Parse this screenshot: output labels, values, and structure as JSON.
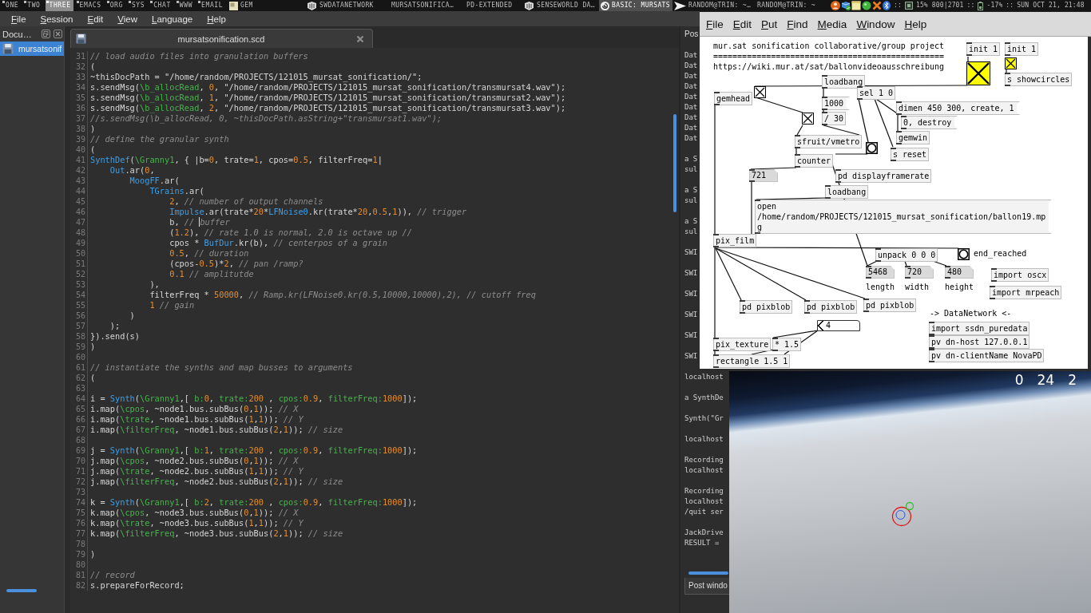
{
  "top_panel": {
    "workspaces": [
      {
        "label": "ONE",
        "selected": false,
        "occupied": true
      },
      {
        "label": "TWO",
        "selected": false,
        "occupied": true
      },
      {
        "label": "THREE",
        "selected": true,
        "occupied": true
      },
      {
        "label": "EMACS",
        "selected": false,
        "occupied": true
      },
      {
        "label": "ORG",
        "selected": false,
        "occupied": true
      },
      {
        "label": "SYS",
        "selected": false,
        "occupied": true
      },
      {
        "label": "CHAT",
        "selected": false,
        "occupied": true
      },
      {
        "label": "WWW",
        "selected": false,
        "occupied": true
      },
      {
        "label": "EMAIL",
        "selected": false,
        "occupied": true
      }
    ],
    "tasks": [
      {
        "label": "GEM",
        "selected": false
      },
      {
        "label": "SWDATANETWORK",
        "selected": false
      },
      {
        "label": "MURSATSONIFICA…",
        "selected": false
      },
      {
        "label": "PD-EXTENDED",
        "selected": false
      },
      {
        "label": "SENSEWORLD DA…",
        "selected": false
      },
      {
        "label": "BASIC: MURSATS",
        "selected": true
      },
      {
        "label": "RANDOM@TRIN: ~…",
        "selected": false
      },
      {
        "label": "RANDOM@TRIN: ~",
        "selected": false
      }
    ],
    "status": [
      {
        "kind": "separator",
        "text": "::"
      },
      {
        "kind": "cpu",
        "text": "15% 800|2701"
      },
      {
        "kind": "separator",
        "text": "::"
      },
      {
        "kind": "battery",
        "text": "-17%"
      },
      {
        "kind": "separator",
        "text": "::"
      },
      {
        "kind": "clock",
        "text": "SUN OCT 21, 21:48"
      }
    ]
  },
  "ide_menu": [
    "File",
    "Session",
    "Edit",
    "View",
    "Language",
    "Help"
  ],
  "documents_panel": {
    "title": "Docu…",
    "items": [
      {
        "label": "mursatsonif",
        "selected": true
      }
    ]
  },
  "editor": {
    "tab_title": "mursatsonification.scd",
    "lines": [
      {
        "number": "31",
        "tokens": [
          {
            "kind": "comment",
            "text": "// load audio files into granulation buffers"
          }
        ]
      },
      {
        "number": "32",
        "tokens": [
          {
            "kind": "plain",
            "text": "("
          }
        ]
      },
      {
        "number": "33",
        "tokens": [
          {
            "kind": "plain",
            "text": "~thisDocPath = \"/home/random/PROJECTS/121015_mursat_sonification/\";"
          }
        ]
      },
      {
        "number": "34",
        "tokens": [
          {
            "kind": "plain",
            "text": "s.sendMsg("
          },
          {
            "kind": "symbol",
            "text": "\\b_allocRead"
          },
          {
            "kind": "plain",
            "text": ", "
          },
          {
            "kind": "number",
            "text": "0"
          },
          {
            "kind": "plain",
            "text": ", \"/home/random/PROJECTS/121015_mursat_sonification/transmursat4.wav\");"
          }
        ]
      },
      {
        "number": "35",
        "tokens": [
          {
            "kind": "plain",
            "text": "s.sendMsg("
          },
          {
            "kind": "symbol",
            "text": "\\b_allocRead"
          },
          {
            "kind": "plain",
            "text": ", "
          },
          {
            "kind": "number",
            "text": "1"
          },
          {
            "kind": "plain",
            "text": ", \"/home/random/PROJECTS/121015_mursat_sonification/transmursat2.wav\");"
          }
        ]
      },
      {
        "number": "36",
        "tokens": [
          {
            "kind": "plain",
            "text": "s.sendMsg("
          },
          {
            "kind": "symbol",
            "text": "\\b_allocRead"
          },
          {
            "kind": "plain",
            "text": ", "
          },
          {
            "kind": "number",
            "text": "2"
          },
          {
            "kind": "plain",
            "text": ", \"/home/random/PROJECTS/121015_mursat_sonification/transmursat3.wav\");"
          }
        ]
      },
      {
        "number": "37",
        "tokens": [
          {
            "kind": "comment",
            "text": "//s.sendMsg(\\b_allocRead, 0, ~thisDocPath.asString+\"transmursat1.wav\");"
          }
        ]
      },
      {
        "number": "38",
        "tokens": [
          {
            "kind": "plain",
            "text": ")"
          }
        ]
      },
      {
        "number": "39",
        "tokens": [
          {
            "kind": "comment",
            "text": "// define the granular synth"
          }
        ]
      },
      {
        "number": "40",
        "tokens": [
          {
            "kind": "plain",
            "text": "("
          }
        ]
      },
      {
        "number": "41",
        "tokens": [
          {
            "kind": "class",
            "text": "SynthDef"
          },
          {
            "kind": "plain",
            "text": "("
          },
          {
            "kind": "symbol",
            "text": "\\Granny1"
          },
          {
            "kind": "plain",
            "text": ", { |b="
          },
          {
            "kind": "number",
            "text": "0"
          },
          {
            "kind": "plain",
            "text": ", trate="
          },
          {
            "kind": "number",
            "text": "1"
          },
          {
            "kind": "plain",
            "text": ", cpos="
          },
          {
            "kind": "number",
            "text": "0.5"
          },
          {
            "kind": "plain",
            "text": ", filterFreq="
          },
          {
            "kind": "number",
            "text": "1"
          },
          {
            "kind": "plain",
            "text": "|"
          }
        ]
      },
      {
        "number": "42",
        "tokens": [
          {
            "kind": "class",
            "text": "    Out"
          },
          {
            "kind": "plain",
            "text": ".ar("
          },
          {
            "kind": "number",
            "text": "0"
          },
          {
            "kind": "plain",
            "text": ","
          }
        ]
      },
      {
        "number": "43",
        "tokens": [
          {
            "kind": "class",
            "text": "        MoogFF"
          },
          {
            "kind": "plain",
            "text": ".ar("
          }
        ]
      },
      {
        "number": "44",
        "tokens": [
          {
            "kind": "class",
            "text": "            TGrains"
          },
          {
            "kind": "plain",
            "text": ".ar("
          }
        ]
      },
      {
        "number": "45",
        "tokens": [
          {
            "kind": "number",
            "text": "                2"
          },
          {
            "kind": "plain",
            "text": ", "
          },
          {
            "kind": "comment",
            "text": "// number of output channels"
          }
        ]
      },
      {
        "number": "46",
        "tokens": [
          {
            "kind": "class",
            "text": "                Impulse"
          },
          {
            "kind": "plain",
            "text": ".ar(trate*"
          },
          {
            "kind": "number",
            "text": "20"
          },
          {
            "kind": "plain",
            "text": "*"
          },
          {
            "kind": "class",
            "text": "LFNoise0"
          },
          {
            "kind": "plain",
            "text": ".kr(trate*"
          },
          {
            "kind": "number",
            "text": "20"
          },
          {
            "kind": "plain",
            "text": ","
          },
          {
            "kind": "number",
            "text": "0.5"
          },
          {
            "kind": "plain",
            "text": ","
          },
          {
            "kind": "number",
            "text": "1"
          },
          {
            "kind": "plain",
            "text": ")), "
          },
          {
            "kind": "comment",
            "text": "// trigger"
          }
        ]
      },
      {
        "number": "47",
        "tokens": [
          {
            "kind": "plain",
            "text": "                b, "
          },
          {
            "kind": "comment",
            "text": "// "
          },
          {
            "kind": "cursor"
          },
          {
            "kind": "comment",
            "text": "buffer"
          }
        ]
      },
      {
        "number": "48",
        "tokens": [
          {
            "kind": "plain",
            "text": "                ("
          },
          {
            "kind": "number",
            "text": "1.2"
          },
          {
            "kind": "plain",
            "text": "), "
          },
          {
            "kind": "comment",
            "text": "// rate 1.0 is normal, 2.0 is octave up //"
          }
        ]
      },
      {
        "number": "49",
        "tokens": [
          {
            "kind": "plain",
            "text": "                cpos * "
          },
          {
            "kind": "class",
            "text": "BufDur"
          },
          {
            "kind": "plain",
            "text": ".kr(b), "
          },
          {
            "kind": "comment",
            "text": "// centerpos of a grain"
          }
        ]
      },
      {
        "number": "50",
        "tokens": [
          {
            "kind": "number",
            "text": "                0.5"
          },
          {
            "kind": "plain",
            "text": ", "
          },
          {
            "kind": "comment",
            "text": "// duration"
          }
        ]
      },
      {
        "number": "51",
        "tokens": [
          {
            "kind": "plain",
            "text": "                (cpos-"
          },
          {
            "kind": "number",
            "text": "0.5"
          },
          {
            "kind": "plain",
            "text": ")*"
          },
          {
            "kind": "number",
            "text": "2"
          },
          {
            "kind": "plain",
            "text": ", "
          },
          {
            "kind": "comment",
            "text": "// pan /ramp?"
          }
        ]
      },
      {
        "number": "52",
        "tokens": [
          {
            "kind": "number",
            "text": "                0.1 "
          },
          {
            "kind": "comment",
            "text": "// amplitutde"
          }
        ]
      },
      {
        "number": "53",
        "tokens": [
          {
            "kind": "plain",
            "text": "            ),"
          }
        ]
      },
      {
        "number": "54",
        "tokens": [
          {
            "kind": "plain",
            "text": "            filterFreq * "
          },
          {
            "kind": "number",
            "text": "50000"
          },
          {
            "kind": "plain",
            "text": ", "
          },
          {
            "kind": "comment",
            "text": "// Ramp.kr(LFNoise0.kr(0.5,10000,10000),2), // cutoff freq"
          }
        ]
      },
      {
        "number": "55",
        "tokens": [
          {
            "kind": "number",
            "text": "            1 "
          },
          {
            "kind": "comment",
            "text": "// gain"
          }
        ]
      },
      {
        "number": "56",
        "tokens": [
          {
            "kind": "plain",
            "text": "        )"
          }
        ]
      },
      {
        "number": "57",
        "tokens": [
          {
            "kind": "plain",
            "text": "    );"
          }
        ]
      },
      {
        "number": "58",
        "tokens": [
          {
            "kind": "plain",
            "text": "}).send(s)"
          }
        ]
      },
      {
        "number": "59",
        "tokens": [
          {
            "kind": "plain",
            "text": ")"
          }
        ]
      },
      {
        "number": "60"
      },
      {
        "number": "61",
        "tokens": [
          {
            "kind": "comment",
            "text": "// instantiate the synths and map busses to arguments"
          }
        ]
      },
      {
        "number": "62",
        "tokens": [
          {
            "kind": "plain",
            "text": "("
          }
        ]
      },
      {
        "number": "63"
      },
      {
        "number": "64",
        "tokens": [
          {
            "kind": "plain",
            "text": "i = "
          },
          {
            "kind": "class",
            "text": "Synth"
          },
          {
            "kind": "plain",
            "text": "("
          },
          {
            "kind": "symbol",
            "text": "\\Granny1"
          },
          {
            "kind": "plain",
            "text": ",[ "
          },
          {
            "kind": "symbol",
            "text": "b:"
          },
          {
            "kind": "number",
            "text": "0"
          },
          {
            "kind": "plain",
            "text": ", "
          },
          {
            "kind": "symbol",
            "text": "trate:"
          },
          {
            "kind": "number",
            "text": "200"
          },
          {
            "kind": "plain",
            "text": " , "
          },
          {
            "kind": "symbol",
            "text": "cpos:"
          },
          {
            "kind": "number",
            "text": "0.9"
          },
          {
            "kind": "plain",
            "text": ", "
          },
          {
            "kind": "symbol",
            "text": "filterFreq:"
          },
          {
            "kind": "number",
            "text": "1000"
          },
          {
            "kind": "plain",
            "text": "]);"
          }
        ]
      },
      {
        "number": "65",
        "tokens": [
          {
            "kind": "plain",
            "text": "i.map("
          },
          {
            "kind": "symbol",
            "text": "\\cpos"
          },
          {
            "kind": "plain",
            "text": ", ~node1.bus.subBus("
          },
          {
            "kind": "number",
            "text": "0"
          },
          {
            "kind": "plain",
            "text": ","
          },
          {
            "kind": "number",
            "text": "1"
          },
          {
            "kind": "plain",
            "text": ")); "
          },
          {
            "kind": "comment",
            "text": "// X"
          }
        ]
      },
      {
        "number": "66",
        "tokens": [
          {
            "kind": "plain",
            "text": "i.map("
          },
          {
            "kind": "symbol",
            "text": "\\trate"
          },
          {
            "kind": "plain",
            "text": ", ~node1.bus.subBus("
          },
          {
            "kind": "number",
            "text": "1"
          },
          {
            "kind": "plain",
            "text": ","
          },
          {
            "kind": "number",
            "text": "1"
          },
          {
            "kind": "plain",
            "text": ")); "
          },
          {
            "kind": "comment",
            "text": "// Y"
          }
        ]
      },
      {
        "number": "67",
        "tokens": [
          {
            "kind": "plain",
            "text": "i.map("
          },
          {
            "kind": "symbol",
            "text": "\\filterFreq"
          },
          {
            "kind": "plain",
            "text": ", ~node1.bus.subBus("
          },
          {
            "kind": "number",
            "text": "2"
          },
          {
            "kind": "plain",
            "text": ","
          },
          {
            "kind": "number",
            "text": "1"
          },
          {
            "kind": "plain",
            "text": ")); "
          },
          {
            "kind": "comment",
            "text": "// size"
          }
        ]
      },
      {
        "number": "68"
      },
      {
        "number": "69",
        "tokens": [
          {
            "kind": "plain",
            "text": "j = "
          },
          {
            "kind": "class",
            "text": "Synth"
          },
          {
            "kind": "plain",
            "text": "("
          },
          {
            "kind": "symbol",
            "text": "\\Granny1"
          },
          {
            "kind": "plain",
            "text": ",[ "
          },
          {
            "kind": "symbol",
            "text": "b:"
          },
          {
            "kind": "number",
            "text": "1"
          },
          {
            "kind": "plain",
            "text": ", "
          },
          {
            "kind": "symbol",
            "text": "trate:"
          },
          {
            "kind": "number",
            "text": "200"
          },
          {
            "kind": "plain",
            "text": " , "
          },
          {
            "kind": "symbol",
            "text": "cpos:"
          },
          {
            "kind": "number",
            "text": "0.9"
          },
          {
            "kind": "plain",
            "text": ", "
          },
          {
            "kind": "symbol",
            "text": "filterFreq:"
          },
          {
            "kind": "number",
            "text": "1000"
          },
          {
            "kind": "plain",
            "text": "]);"
          }
        ]
      },
      {
        "number": "70",
        "tokens": [
          {
            "kind": "plain",
            "text": "j.map("
          },
          {
            "kind": "symbol",
            "text": "\\cpos"
          },
          {
            "kind": "plain",
            "text": ", ~node2.bus.subBus("
          },
          {
            "kind": "number",
            "text": "0"
          },
          {
            "kind": "plain",
            "text": ","
          },
          {
            "kind": "number",
            "text": "1"
          },
          {
            "kind": "plain",
            "text": ")); "
          },
          {
            "kind": "comment",
            "text": "// X"
          }
        ]
      },
      {
        "number": "71",
        "tokens": [
          {
            "kind": "plain",
            "text": "j.map("
          },
          {
            "kind": "symbol",
            "text": "\\trate"
          },
          {
            "kind": "plain",
            "text": ", ~node2.bus.subBus("
          },
          {
            "kind": "number",
            "text": "1"
          },
          {
            "kind": "plain",
            "text": ","
          },
          {
            "kind": "number",
            "text": "1"
          },
          {
            "kind": "plain",
            "text": ")); "
          },
          {
            "kind": "comment",
            "text": "// Y"
          }
        ]
      },
      {
        "number": "72",
        "tokens": [
          {
            "kind": "plain",
            "text": "j.map("
          },
          {
            "kind": "symbol",
            "text": "\\filterFreq"
          },
          {
            "kind": "plain",
            "text": ", ~node2.bus.subBus("
          },
          {
            "kind": "number",
            "text": "2"
          },
          {
            "kind": "plain",
            "text": ","
          },
          {
            "kind": "number",
            "text": "1"
          },
          {
            "kind": "plain",
            "text": ")); "
          },
          {
            "kind": "comment",
            "text": "// size"
          }
        ]
      },
      {
        "number": "73"
      },
      {
        "number": "74",
        "tokens": [
          {
            "kind": "plain",
            "text": "k = "
          },
          {
            "kind": "class",
            "text": "Synth"
          },
          {
            "kind": "plain",
            "text": "("
          },
          {
            "kind": "symbol",
            "text": "\\Granny1"
          },
          {
            "kind": "plain",
            "text": ",[ "
          },
          {
            "kind": "symbol",
            "text": "b:"
          },
          {
            "kind": "number",
            "text": "2"
          },
          {
            "kind": "plain",
            "text": ", "
          },
          {
            "kind": "symbol",
            "text": "trate:"
          },
          {
            "kind": "number",
            "text": "200"
          },
          {
            "kind": "plain",
            "text": " , "
          },
          {
            "kind": "symbol",
            "text": "cpos:"
          },
          {
            "kind": "number",
            "text": "0.9"
          },
          {
            "kind": "plain",
            "text": ", "
          },
          {
            "kind": "symbol",
            "text": "filterFreq:"
          },
          {
            "kind": "number",
            "text": "1000"
          },
          {
            "kind": "plain",
            "text": "]);"
          }
        ]
      },
      {
        "number": "75",
        "tokens": [
          {
            "kind": "plain",
            "text": "k.map("
          },
          {
            "kind": "symbol",
            "text": "\\cpos"
          },
          {
            "kind": "plain",
            "text": ", ~node3.bus.subBus("
          },
          {
            "kind": "number",
            "text": "0"
          },
          {
            "kind": "plain",
            "text": ","
          },
          {
            "kind": "number",
            "text": "1"
          },
          {
            "kind": "plain",
            "text": ")); "
          },
          {
            "kind": "comment",
            "text": "// X"
          }
        ]
      },
      {
        "number": "76",
        "tokens": [
          {
            "kind": "plain",
            "text": "k.map("
          },
          {
            "kind": "symbol",
            "text": "\\trate"
          },
          {
            "kind": "plain",
            "text": ", ~node3.bus.subBus("
          },
          {
            "kind": "number",
            "text": "1"
          },
          {
            "kind": "plain",
            "text": ","
          },
          {
            "kind": "number",
            "text": "1"
          },
          {
            "kind": "plain",
            "text": ")); "
          },
          {
            "kind": "comment",
            "text": "// Y"
          }
        ]
      },
      {
        "number": "77",
        "tokens": [
          {
            "kind": "plain",
            "text": "k.map("
          },
          {
            "kind": "symbol",
            "text": "\\filterFreq"
          },
          {
            "kind": "plain",
            "text": ", ~node3.bus.subBus("
          },
          {
            "kind": "number",
            "text": "2"
          },
          {
            "kind": "plain",
            "text": ","
          },
          {
            "kind": "number",
            "text": "1"
          },
          {
            "kind": "plain",
            "text": ")); "
          },
          {
            "kind": "comment",
            "text": "// size"
          }
        ]
      },
      {
        "number": "78"
      },
      {
        "number": "79",
        "tokens": [
          {
            "kind": "plain",
            "text": ")"
          }
        ]
      },
      {
        "number": "80"
      },
      {
        "number": "81",
        "tokens": [
          {
            "kind": "comment",
            "text": "// record"
          }
        ]
      },
      {
        "number": "82",
        "tokens": [
          {
            "kind": "plain",
            "text": "s.prepareForRecord;"
          }
        ]
      }
    ]
  },
  "post_window": {
    "title": "Pos",
    "entries": [
      [
        "Dat",
        "Dat",
        "Dat",
        "Dat",
        "Dat",
        "Dat",
        "Dat",
        "Dat",
        "Dat"
      ],
      [
        "a S",
        "sul"
      ],
      [
        "a S",
        "sul"
      ],
      [
        "a S",
        "sul"
      ],
      [
        "SWI"
      ],
      [
        "SWI"
      ],
      [
        "SWI"
      ],
      [
        "SWI"
      ],
      [
        "SWI"
      ],
      [
        "SWI"
      ],
      [
        "localhost"
      ],
      [
        "a SynthDe"
      ],
      [
        "Synth(\"Gr"
      ],
      [
        "localhost"
      ],
      [
        "Recording",
        "localhost"
      ],
      [
        "Recording",
        "localhost",
        "/quit ser"
      ],
      [
        "JackDrive",
        "RESULT ="
      ]
    ],
    "tab_label": "Post windo"
  },
  "pd_window": {
    "menu": [
      "File",
      "Edit",
      "Put",
      "Find",
      "Media",
      "Window",
      "Help"
    ],
    "objects": [
      {
        "kind": "comment",
        "text": "mur.sat sonification collaborative/group project ================================================ https://wiki.mur.at/sat/ballonvideoausschreibung"
      },
      {
        "kind": "object",
        "text": "init 1"
      },
      {
        "kind": "object",
        "text": "init 1"
      },
      {
        "kind": "object",
        "text": "loadbang"
      },
      {
        "kind": "toggle",
        "checked": true,
        "color": "#ffff00"
      },
      {
        "kind": "toggle",
        "checked": true,
        "color": "#ffff00"
      },
      {
        "kind": "object",
        "text": "s showcircles"
      },
      {
        "kind": "object",
        "text": "gemhead"
      },
      {
        "kind": "toggle",
        "checked": true
      },
      {
        "kind": "message",
        "text": "1000"
      },
      {
        "kind": "object",
        "text": "sel 1 0"
      },
      {
        "kind": "toggle",
        "checked": true
      },
      {
        "kind": "object",
        "text": "/ 30"
      },
      {
        "kind": "message",
        "text": "dimen 450 300, create, 1"
      },
      {
        "kind": "message",
        "text": "0, destroy"
      },
      {
        "kind": "object",
        "text": "sfruit/vmetro"
      },
      {
        "kind": "bang"
      },
      {
        "kind": "object",
        "text": "gemwin"
      },
      {
        "kind": "object",
        "text": "counter"
      },
      {
        "kind": "object",
        "text": "s reset"
      },
      {
        "kind": "atom",
        "text": "721"
      },
      {
        "kind": "object",
        "text": "pd displayframerate"
      },
      {
        "kind": "object",
        "text": "loadbang"
      },
      {
        "kind": "message",
        "text": "open /home/random/PROJECTS/121015_mursat_sonification/ballon19.mpg"
      },
      {
        "kind": "object",
        "text": "pix_film"
      },
      {
        "kind": "object",
        "text": "unpack 0 0 0"
      },
      {
        "kind": "bang"
      },
      {
        "kind": "comment",
        "text": "end_reached"
      },
      {
        "kind": "atom",
        "text": "5468"
      },
      {
        "kind": "atom",
        "text": "720"
      },
      {
        "kind": "atom",
        "text": "480"
      },
      {
        "kind": "object",
        "text": "import oscx"
      },
      {
        "kind": "comment",
        "text": "length"
      },
      {
        "kind": "comment",
        "text": "width"
      },
      {
        "kind": "comment",
        "text": "height"
      },
      {
        "kind": "object",
        "text": "import mrpeach"
      },
      {
        "kind": "object",
        "text": "pd pixblob"
      },
      {
        "kind": "object",
        "text": "pd pixblob"
      },
      {
        "kind": "object",
        "text": "pd pixblob"
      },
      {
        "kind": "comment",
        "text": "-> DataNetwork <-"
      },
      {
        "kind": "numberbox",
        "text": "4"
      },
      {
        "kind": "object",
        "text": "import ssdn_puredata"
      },
      {
        "kind": "object",
        "text": "pix_texture"
      },
      {
        "kind": "object",
        "text": "* 1.5"
      },
      {
        "kind": "object",
        "text": "pv dn-host 127.0.0.1"
      },
      {
        "kind": "object",
        "text": "rectangle 1.5 1"
      },
      {
        "kind": "object",
        "text": "pv dn-clientName NovaPD"
      }
    ]
  },
  "gem_window": {
    "overlay": [
      "0",
      "24",
      "2"
    ]
  }
}
